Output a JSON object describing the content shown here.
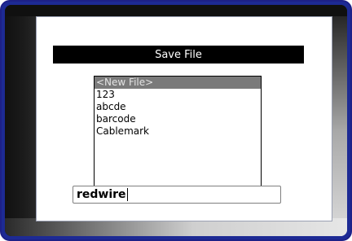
{
  "dialog": {
    "title": "Save File"
  },
  "file_list": {
    "items": [
      {
        "label": "<New File>",
        "selected": true
      },
      {
        "label": "123",
        "selected": false
      },
      {
        "label": "abcde",
        "selected": false
      },
      {
        "label": "barcode",
        "selected": false
      },
      {
        "label": "Cablemark",
        "selected": false
      }
    ]
  },
  "filename_input": {
    "value": "redwire"
  },
  "colors": {
    "frame_border": "#1d2088",
    "title_bar_bg": "#000000",
    "selection_bg": "#7a7a7a"
  }
}
